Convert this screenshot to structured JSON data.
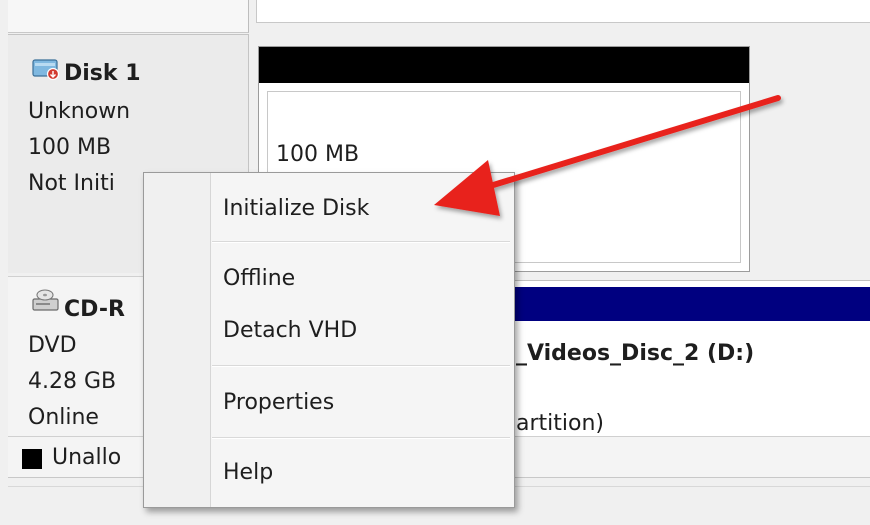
{
  "disks": [
    {
      "icon": "disk-icon",
      "name": "Disk 1",
      "type": "Unknown",
      "size": "100 MB",
      "status": "Not Initialized",
      "status_visible": "Not Initi",
      "volume_size": "100 MB"
    },
    {
      "icon": "cd-rom-icon",
      "name_visible": "CD-R",
      "type": "DVD",
      "size": "4.28 GB",
      "status": "Online",
      "volume_label_visible": "_Videos_Disc_2  (D:)",
      "volume_detail_visible": "artition)"
    }
  ],
  "legend": {
    "unallocated_visible": "Unallo",
    "unallocated_color": "#000000"
  },
  "context_menu": {
    "items": [
      {
        "label": "Initialize Disk"
      },
      {
        "label": "Offline"
      },
      {
        "label": "Detach VHD"
      },
      {
        "label": "Properties"
      },
      {
        "label": "Help"
      }
    ]
  },
  "colors": {
    "unallocated_header": "#000000",
    "primary_partition_header": "#000080",
    "arrow": "#e8231f"
  }
}
